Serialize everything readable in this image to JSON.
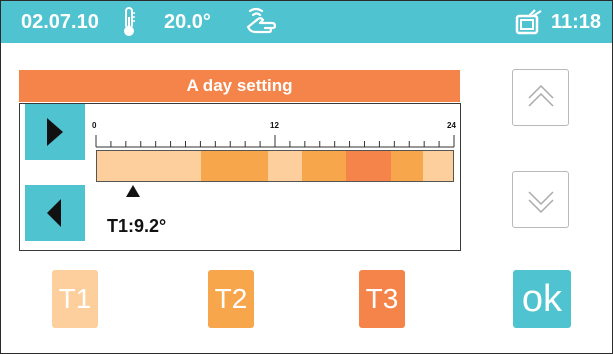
{
  "status_bar": {
    "date": "02.07.10",
    "temperature": "20.0°",
    "time": "11:18",
    "icons": [
      "thermometer-icon",
      "hand-wave-icon",
      "tv-icon"
    ]
  },
  "panel": {
    "title": "A day setting",
    "timeline_labels": [
      "0",
      "12",
      "24"
    ],
    "cursor_label": "T1:9.2°"
  },
  "schedule": {
    "hours_total": 24,
    "segments": [
      {
        "level": "T1",
        "hours": 7
      },
      {
        "level": "T2",
        "hours": 4.5
      },
      {
        "level": "T1",
        "hours": 2.3
      },
      {
        "level": "T2",
        "hours": 3
      },
      {
        "level": "T3",
        "hours": 3
      },
      {
        "level": "T2",
        "hours": 2.2
      },
      {
        "level": "T1",
        "hours": 2
      }
    ],
    "cursor_hour": 2.5
  },
  "colors": {
    "accent": "#4fc3cf",
    "T1": "#fdcf9c",
    "T2": "#f8a64b",
    "T3": "#f5844a",
    "title_bar": "#f5844a"
  },
  "buttons": {
    "t1": "T1",
    "t2": "T2",
    "t3": "T3",
    "ok": "ok"
  }
}
